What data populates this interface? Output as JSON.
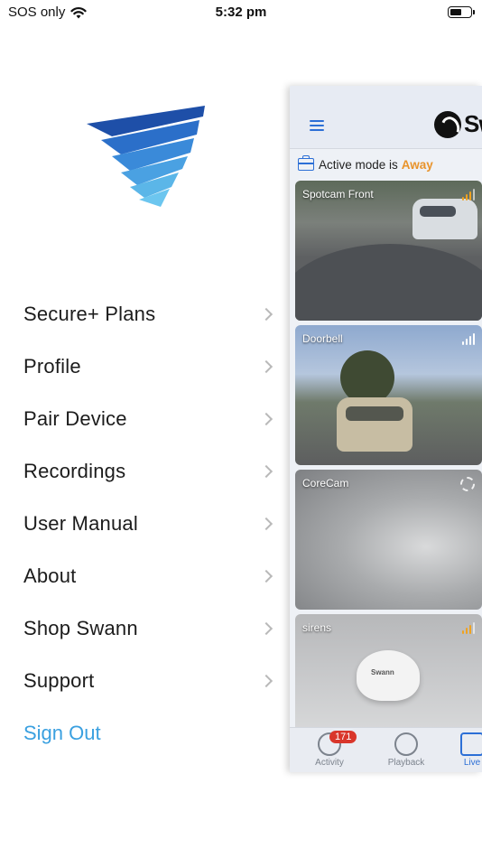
{
  "status_bar": {
    "carrier": "SOS only",
    "time": "5:32 pm"
  },
  "menu": {
    "items": [
      {
        "label": "Secure+ Plans"
      },
      {
        "label": "Profile"
      },
      {
        "label": "Pair Device"
      },
      {
        "label": "Recordings"
      },
      {
        "label": "User Manual"
      },
      {
        "label": "About"
      },
      {
        "label": "Shop Swann"
      },
      {
        "label": "Support"
      }
    ],
    "sign_out": "Sign Out"
  },
  "app_preview": {
    "brand_text": "Sw",
    "mode_prefix": "Active mode is",
    "mode_value": "Away",
    "cameras": [
      {
        "name": "Spotcam Front"
      },
      {
        "name": "Doorbell"
      },
      {
        "name": "CoreCam"
      },
      {
        "name": "sirens"
      }
    ],
    "siren_label": "Swann",
    "tabs": [
      {
        "label": "Activity",
        "badge": "171"
      },
      {
        "label": "Playback"
      },
      {
        "label": "Live"
      }
    ]
  },
  "colors": {
    "accent_blue": "#2c6fd6",
    "sign_out": "#3aa0e0",
    "away": "#e8932b",
    "badge": "#d9362b"
  }
}
